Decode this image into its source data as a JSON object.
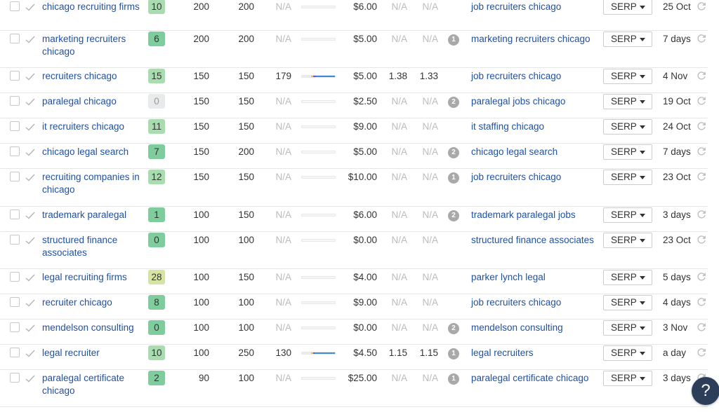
{
  "colors": {
    "link": "#1f50a8",
    "kd_gray": "#e8eaeb",
    "kd_green_dark": "#7fcd9c",
    "kd_green_light": "#a9ddb0",
    "kd_yellowgreen": "#d6e4a3",
    "bar_yellow": "#f3c51a",
    "bar_purple": "#9747b8",
    "bar_blue": "#3d8bd9",
    "help_bg": "#2c3e59"
  },
  "serp_label": "SERP",
  "help_label": "?",
  "rows": [
    {
      "keyword": "chicago recruiting firms",
      "kd": "10",
      "kd_color": "#a9ddb0",
      "volume": "200",
      "global_volume": "200",
      "traffic_potential": "N/A",
      "clicks": null,
      "cpc": "$6.00",
      "cps": "N/A",
      "rr": "N/A",
      "serp_features": "",
      "parent_topic": "job recruiters chicago",
      "updated": "25 Oct",
      "height": 46
    },
    {
      "keyword": "marketing recruiters chicago",
      "kd": "6",
      "kd_color": "#7fcd9c",
      "volume": "200",
      "global_volume": "200",
      "traffic_potential": "N/A",
      "clicks": null,
      "cpc": "$5.00",
      "cps": "N/A",
      "rr": "N/A",
      "serp_features": "1",
      "parent_topic": "marketing recruiters chicago",
      "updated": "7 days",
      "height": 53
    },
    {
      "keyword": "recruiters chicago",
      "kd": "15",
      "kd_color": "#a9ddb0",
      "volume": "150",
      "global_volume": "150",
      "traffic_potential": "179",
      "clicks": {
        "organic_no_clicks": 0.28,
        "paid": 0.07,
        "organic": 0.08,
        "clicks": 0.57
      },
      "cpc": "$5.00",
      "cps": "1.38",
      "rr": "1.33",
      "serp_features": "",
      "parent_topic": "job recruiters chicago",
      "updated": "4 Nov",
      "height": 36
    },
    {
      "keyword": "paralegal chicago",
      "kd": "0",
      "kd_color": "#e8eaeb",
      "volume": "150",
      "global_volume": "150",
      "traffic_potential": "N/A",
      "clicks": null,
      "cpc": "$2.50",
      "cps": "N/A",
      "rr": "N/A",
      "serp_features": "2",
      "parent_topic": "paralegal jobs chicago",
      "updated": "19 Oct",
      "height": 36
    },
    {
      "keyword": "it recruiters chicago",
      "kd": "11",
      "kd_color": "#a9ddb0",
      "volume": "150",
      "global_volume": "150",
      "traffic_potential": "N/A",
      "clicks": null,
      "cpc": "$9.00",
      "cps": "N/A",
      "rr": "N/A",
      "serp_features": "",
      "parent_topic": "it staffing chicago",
      "updated": "24 Oct",
      "height": 36
    },
    {
      "keyword": "chicago legal search",
      "kd": "7",
      "kd_color": "#7fcd9c",
      "volume": "150",
      "global_volume": "200",
      "traffic_potential": "N/A",
      "clicks": null,
      "cpc": "$5.00",
      "cps": "N/A",
      "rr": "N/A",
      "serp_features": "2",
      "parent_topic": "chicago legal search",
      "updated": "7 days",
      "height": 36
    },
    {
      "keyword": "recruiting companies in chicago",
      "kd": "12",
      "kd_color": "#a9ddb0",
      "volume": "150",
      "global_volume": "150",
      "traffic_potential": "N/A",
      "clicks": null,
      "cpc": "$10.00",
      "cps": "N/A",
      "rr": "N/A",
      "serp_features": "1",
      "parent_topic": "job recruiters chicago",
      "updated": "23 Oct",
      "height": 54
    },
    {
      "keyword": "trademark paralegal",
      "kd": "1",
      "kd_color": "#7fcd9c",
      "volume": "100",
      "global_volume": "150",
      "traffic_potential": "N/A",
      "clicks": null,
      "cpc": "$6.00",
      "cps": "N/A",
      "rr": "N/A",
      "serp_features": "2",
      "parent_topic": "trademark paralegal jobs",
      "updated": "3 days",
      "height": 36
    },
    {
      "keyword": "structured finance associates",
      "kd": "0",
      "kd_color": "#7fcd9c",
      "volume": "100",
      "global_volume": "100",
      "traffic_potential": "N/A",
      "clicks": null,
      "cpc": "$0.00",
      "cps": "N/A",
      "rr": "N/A",
      "serp_features": "",
      "parent_topic": "structured finance associates",
      "updated": "23 Oct",
      "height": 53
    },
    {
      "keyword": "legal recruiting firms",
      "kd": "28",
      "kd_color": "#d6e4a3",
      "volume": "100",
      "global_volume": "150",
      "traffic_potential": "N/A",
      "clicks": null,
      "cpc": "$4.00",
      "cps": "N/A",
      "rr": "N/A",
      "serp_features": "",
      "parent_topic": "parker lynch legal",
      "updated": "5 days",
      "height": 36
    },
    {
      "keyword": "recruiter chicago",
      "kd": "8",
      "kd_color": "#7fcd9c",
      "volume": "100",
      "global_volume": "100",
      "traffic_potential": "N/A",
      "clicks": null,
      "cpc": "$9.00",
      "cps": "N/A",
      "rr": "N/A",
      "serp_features": "",
      "parent_topic": "job recruiters chicago",
      "updated": "4 days",
      "height": 36
    },
    {
      "keyword": "mendelson consulting",
      "kd": "0",
      "kd_color": "#7fcd9c",
      "volume": "100",
      "global_volume": "100",
      "traffic_potential": "N/A",
      "clicks": null,
      "cpc": "$0.00",
      "cps": "N/A",
      "rr": "N/A",
      "serp_features": "2",
      "parent_topic": "mendelson consulting",
      "updated": "3 Nov",
      "height": 36
    },
    {
      "keyword": "legal recruiter",
      "kd": "10",
      "kd_color": "#a9ddb0",
      "volume": "100",
      "global_volume": "250",
      "traffic_potential": "130",
      "clicks": {
        "organic_no_clicks": 0.28,
        "paid": 0.07,
        "organic": 0.03,
        "clicks": 0.62
      },
      "cpc": "$4.50",
      "cps": "1.15",
      "rr": "1.15",
      "serp_features": "1",
      "parent_topic": "legal recruiters",
      "updated": "a day",
      "height": 36
    },
    {
      "keyword": "paralegal certificate chicago",
      "kd": "2",
      "kd_color": "#7fcd9c",
      "volume": "90",
      "global_volume": "100",
      "traffic_potential": "N/A",
      "clicks": null,
      "cpc": "$25.00",
      "cps": "N/A",
      "rr": "N/A",
      "serp_features": "1",
      "parent_topic": "paralegal certificate chicago",
      "updated": "3 days",
      "height": 53
    }
  ]
}
